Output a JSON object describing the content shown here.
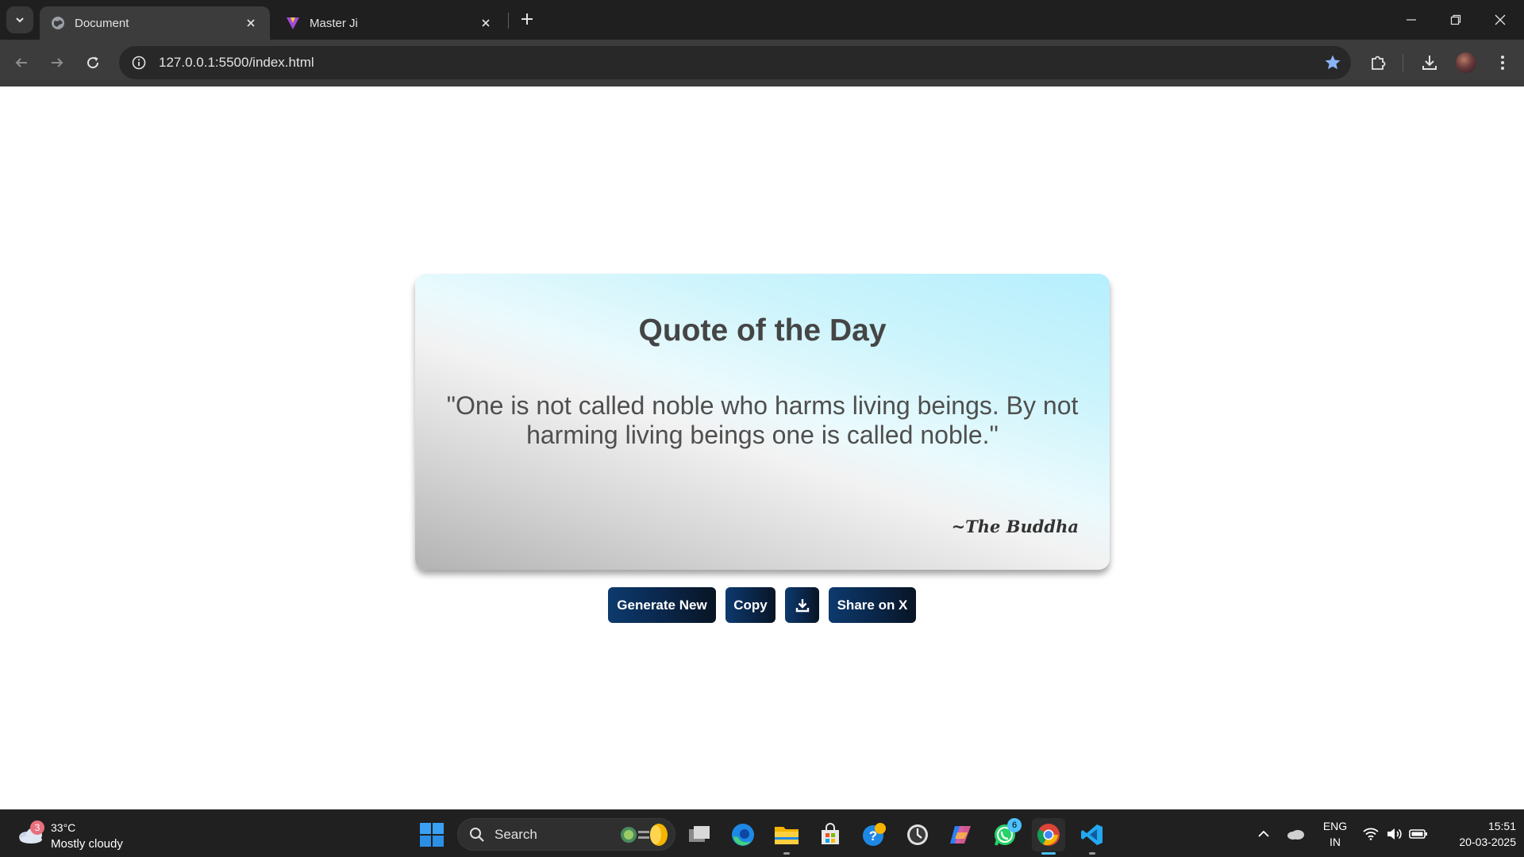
{
  "browser": {
    "tabs": [
      {
        "title": "Document",
        "favicon": "globe-icon",
        "active": true
      },
      {
        "title": "Master Ji",
        "favicon": "master-ji-logo-icon",
        "active": false
      }
    ],
    "url": "127.0.0.1:5500/index.html",
    "accent_color": "#8ab4f8"
  },
  "page": {
    "card": {
      "title": "Quote of the Day",
      "quote": "\"One is not called noble who harms living beings. By not harming living beings one is called noble.\"",
      "author": "~The Buddha"
    },
    "buttons": {
      "generate": "Generate New",
      "copy": "Copy",
      "download_icon": "download-icon",
      "share": "Share on X"
    },
    "colors": {
      "button_start": "#0d3a6e",
      "button_end": "#081524",
      "title_text": "#454545"
    }
  },
  "taskbar": {
    "weather": {
      "badge": "3",
      "temp": "33°C",
      "desc": "Mostly cloudy"
    },
    "search_label": "Search",
    "apps": [
      "task-view-icon",
      "edge-icon",
      "file-explorer-icon",
      "ms-store-icon",
      "help-icon",
      "clock-app-icon",
      "copilot-icon",
      "whatsapp-icon",
      "chrome-icon",
      "vscode-icon"
    ],
    "whatsapp_badge": "6",
    "lang_line1": "ENG",
    "lang_line2": "IN",
    "time": "15:51",
    "date": "20-03-2025"
  }
}
